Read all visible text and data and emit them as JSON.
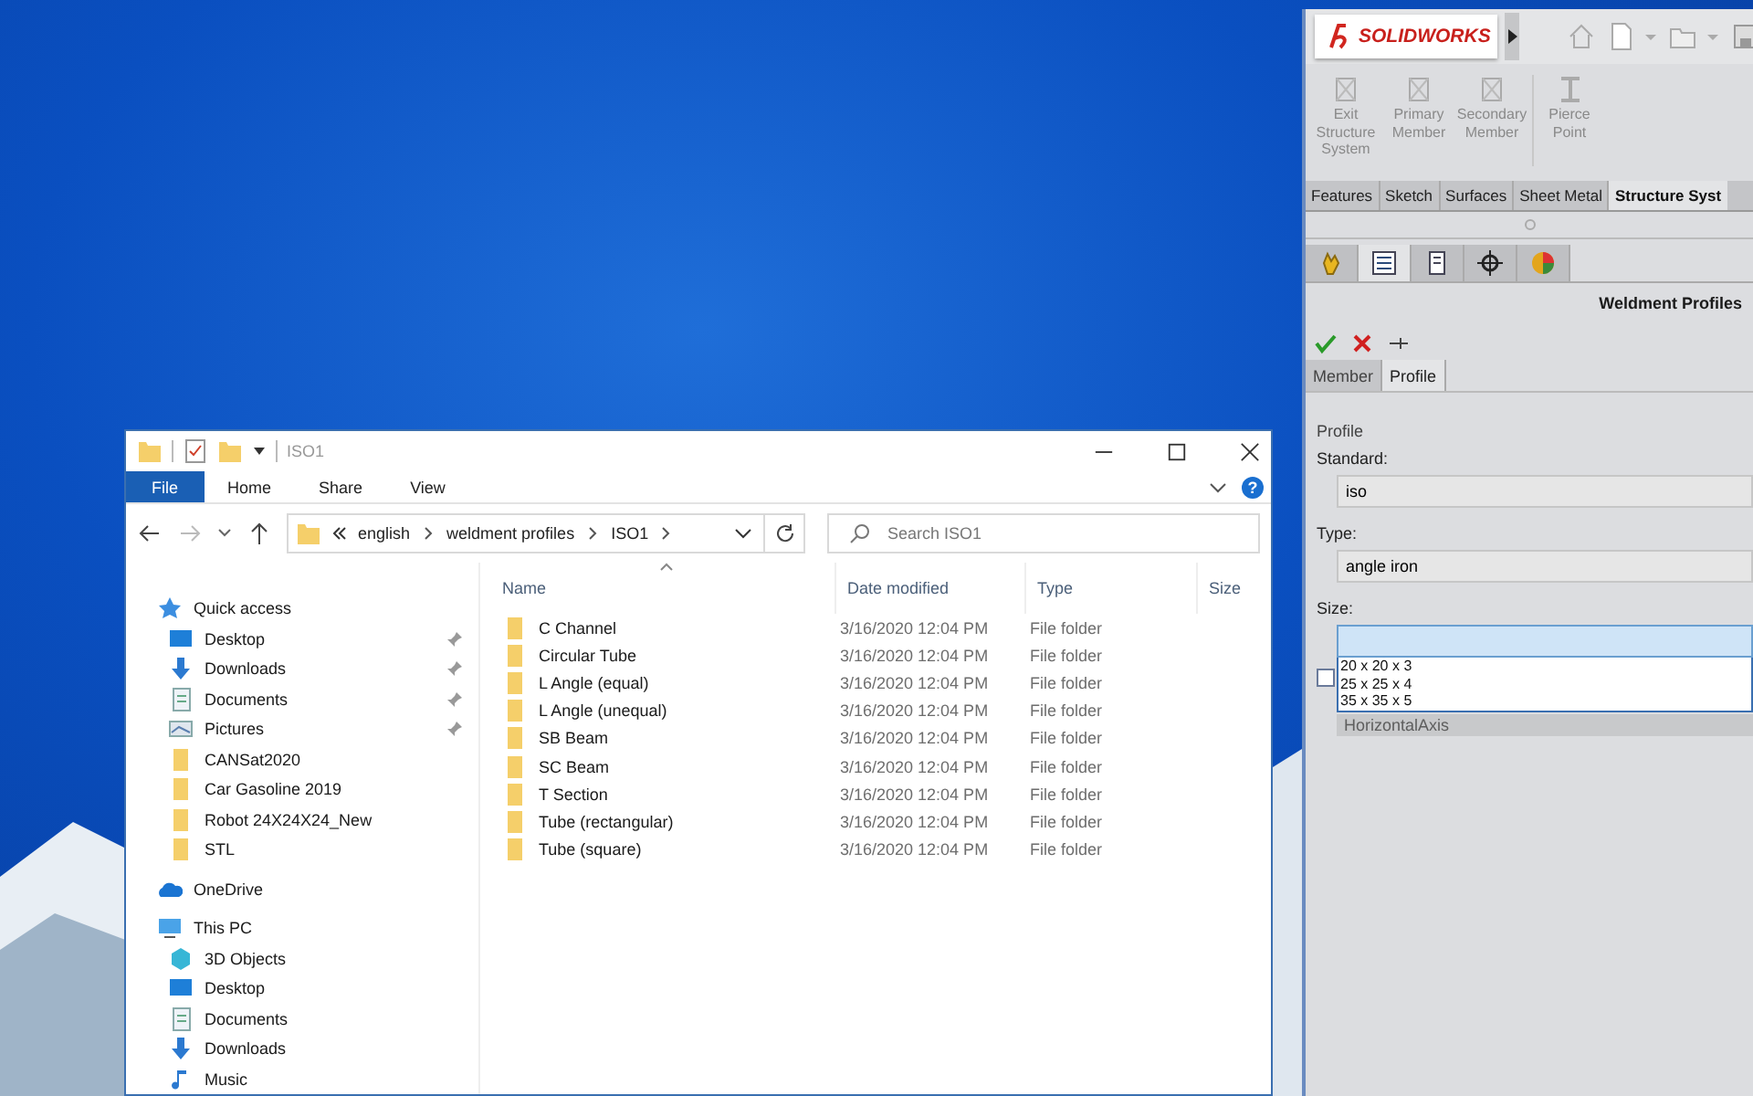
{
  "explorer": {
    "title": "ISO1",
    "ribbon_tabs": [
      {
        "label": "File",
        "kind": "file"
      },
      {
        "label": "Home",
        "kind": "tab"
      },
      {
        "label": "Share",
        "kind": "tab"
      },
      {
        "label": "View",
        "kind": "tab"
      }
    ],
    "help": "?",
    "breadcrumbs": [
      "english",
      "weldment profiles",
      "ISO1"
    ],
    "search": {
      "placeholder": "Search ISO1"
    },
    "nav": [
      {
        "label": "Quick access",
        "kind": "star",
        "children": [
          {
            "label": "Desktop",
            "kind": "desktop",
            "pinned": true
          },
          {
            "label": "Downloads",
            "kind": "download",
            "pinned": true
          },
          {
            "label": "Documents",
            "kind": "document",
            "pinned": true
          },
          {
            "label": "Pictures",
            "kind": "picture",
            "pinned": true
          },
          {
            "label": "CANSat2020",
            "kind": "folder",
            "pinned": false
          },
          {
            "label": "Car Gasoline 2019",
            "kind": "folder",
            "pinned": false
          },
          {
            "label": "Robot 24X24X24_New",
            "kind": "folder",
            "pinned": false
          },
          {
            "label": "STL",
            "kind": "folder",
            "pinned": false
          }
        ]
      },
      {
        "label": "OneDrive",
        "kind": "cloud"
      },
      {
        "label": "This PC",
        "kind": "pc",
        "children": [
          {
            "label": "3D Objects",
            "kind": "cube",
            "pinned": false
          },
          {
            "label": "Desktop",
            "kind": "desktop",
            "pinned": false
          },
          {
            "label": "Documents",
            "kind": "document",
            "pinned": false
          },
          {
            "label": "Downloads",
            "kind": "download",
            "pinned": false
          },
          {
            "label": "Music",
            "kind": "music",
            "pinned": false
          }
        ]
      }
    ],
    "columns": [
      "Name",
      "Date modified",
      "Type",
      "Size"
    ],
    "rows": [
      {
        "name": "C Channel",
        "date": "3/16/2020 12:04 PM",
        "type": "File folder"
      },
      {
        "name": "Circular Tube",
        "date": "3/16/2020 12:04 PM",
        "type": "File folder"
      },
      {
        "name": "L Angle (equal)",
        "date": "3/16/2020 12:04 PM",
        "type": "File folder"
      },
      {
        "name": "L Angle (unequal)",
        "date": "3/16/2020 12:04 PM",
        "type": "File folder"
      },
      {
        "name": "SB Beam",
        "date": "3/16/2020 12:04 PM",
        "type": "File folder"
      },
      {
        "name": "SC Beam",
        "date": "3/16/2020 12:04 PM",
        "type": "File folder"
      },
      {
        "name": "T Section",
        "date": "3/16/2020 12:04 PM",
        "type": "File folder"
      },
      {
        "name": "Tube (rectangular)",
        "date": "3/16/2020 12:04 PM",
        "type": "File folder"
      },
      {
        "name": "Tube (square)",
        "date": "3/16/2020 12:04 PM",
        "type": "File folder"
      }
    ]
  },
  "solidworks": {
    "logo": "SOLIDWORKS",
    "commands": [
      {
        "label": "Exit Structure System",
        "disabled": true
      },
      {
        "label": "Primary Member",
        "disabled": true
      },
      {
        "label": "Secondary Member",
        "disabled": true
      },
      {
        "label": "Pierce Point",
        "disabled": true
      }
    ],
    "tabs": [
      {
        "label": "Features",
        "selected": false
      },
      {
        "label": "Sketch",
        "selected": false
      },
      {
        "label": "Surfaces",
        "selected": false
      },
      {
        "label": "Sheet Metal",
        "selected": false
      },
      {
        "label": "Structure Syst",
        "selected": true
      }
    ],
    "manager_tabs": [
      {
        "kind": "hand",
        "selected": false
      },
      {
        "kind": "tree",
        "selected": true
      },
      {
        "kind": "property",
        "selected": false
      },
      {
        "kind": "target",
        "selected": false
      },
      {
        "kind": "appearance",
        "selected": false
      }
    ],
    "title": "Weldment Profiles",
    "sub_tabs": [
      {
        "label": "Member",
        "selected": false
      },
      {
        "label": "Profile",
        "selected": true
      }
    ],
    "group": "Profile",
    "fields": [
      {
        "label": "Standard:",
        "value": "iso"
      },
      {
        "label": "Type:",
        "value": "angle iron"
      },
      {
        "label": "Size:"
      }
    ],
    "size_options": [
      "20 x 20 x 3",
      "25 x 25 x 4",
      "35 x 35 x 5"
    ],
    "checkbox": {
      "checked": false
    },
    "hidden_field": "HorizontalAxis"
  }
}
